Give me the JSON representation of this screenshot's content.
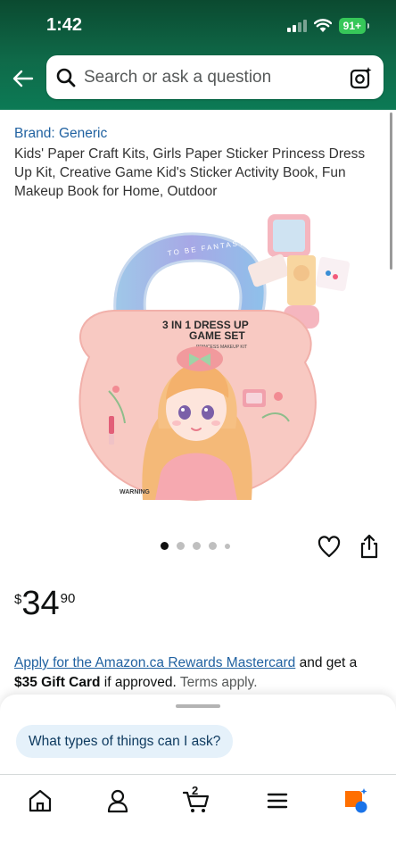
{
  "status_bar": {
    "time": "1:42",
    "battery": "91+"
  },
  "search": {
    "placeholder": "Search or ask a question"
  },
  "product": {
    "brand": "Brand: Generic",
    "title": "Kids' Paper Craft Kits, Girls Paper Sticker Princess Dress Up Kit, Creative Game Kid's Sticker Activity Book, Fun Makeup Book for Home, Outdoor",
    "image": {
      "handle_text": "TO BE FANTASY",
      "box_title_line1": "3 IN 1 DRESS UP",
      "box_title_line2": "GAME SET",
      "box_subtitle": "PRINCESS MAKEUP KIT",
      "warning": "WARNING"
    },
    "carousel": {
      "total_images": 5,
      "active_index": 0
    }
  },
  "price": {
    "symbol": "$",
    "whole": "34",
    "fraction": "90"
  },
  "promo": {
    "link_text": "Apply for the Amazon.ca Rewards Mastercard",
    "text_after_link": " and get a ",
    "gift_card": "$35 Gift Card",
    "text_if": " if approved.",
    "terms": " Terms apply."
  },
  "rufus": {
    "suggestion": "What types of things can I ask?"
  },
  "nav": {
    "cart_count": "2"
  },
  "colors": {
    "header_bg": "#0f6a49",
    "link": "#2162a1",
    "chip_bg": "#e5f1fa",
    "rufus_orange": "#ff6f00",
    "rufus_blue": "#1a73e8"
  },
  "icons": [
    "back-arrow-icon",
    "search-icon",
    "camera-lens-icon",
    "heart-icon",
    "share-icon",
    "home-icon",
    "profile-icon",
    "cart-icon",
    "menu-icon",
    "rufus-icon"
  ]
}
